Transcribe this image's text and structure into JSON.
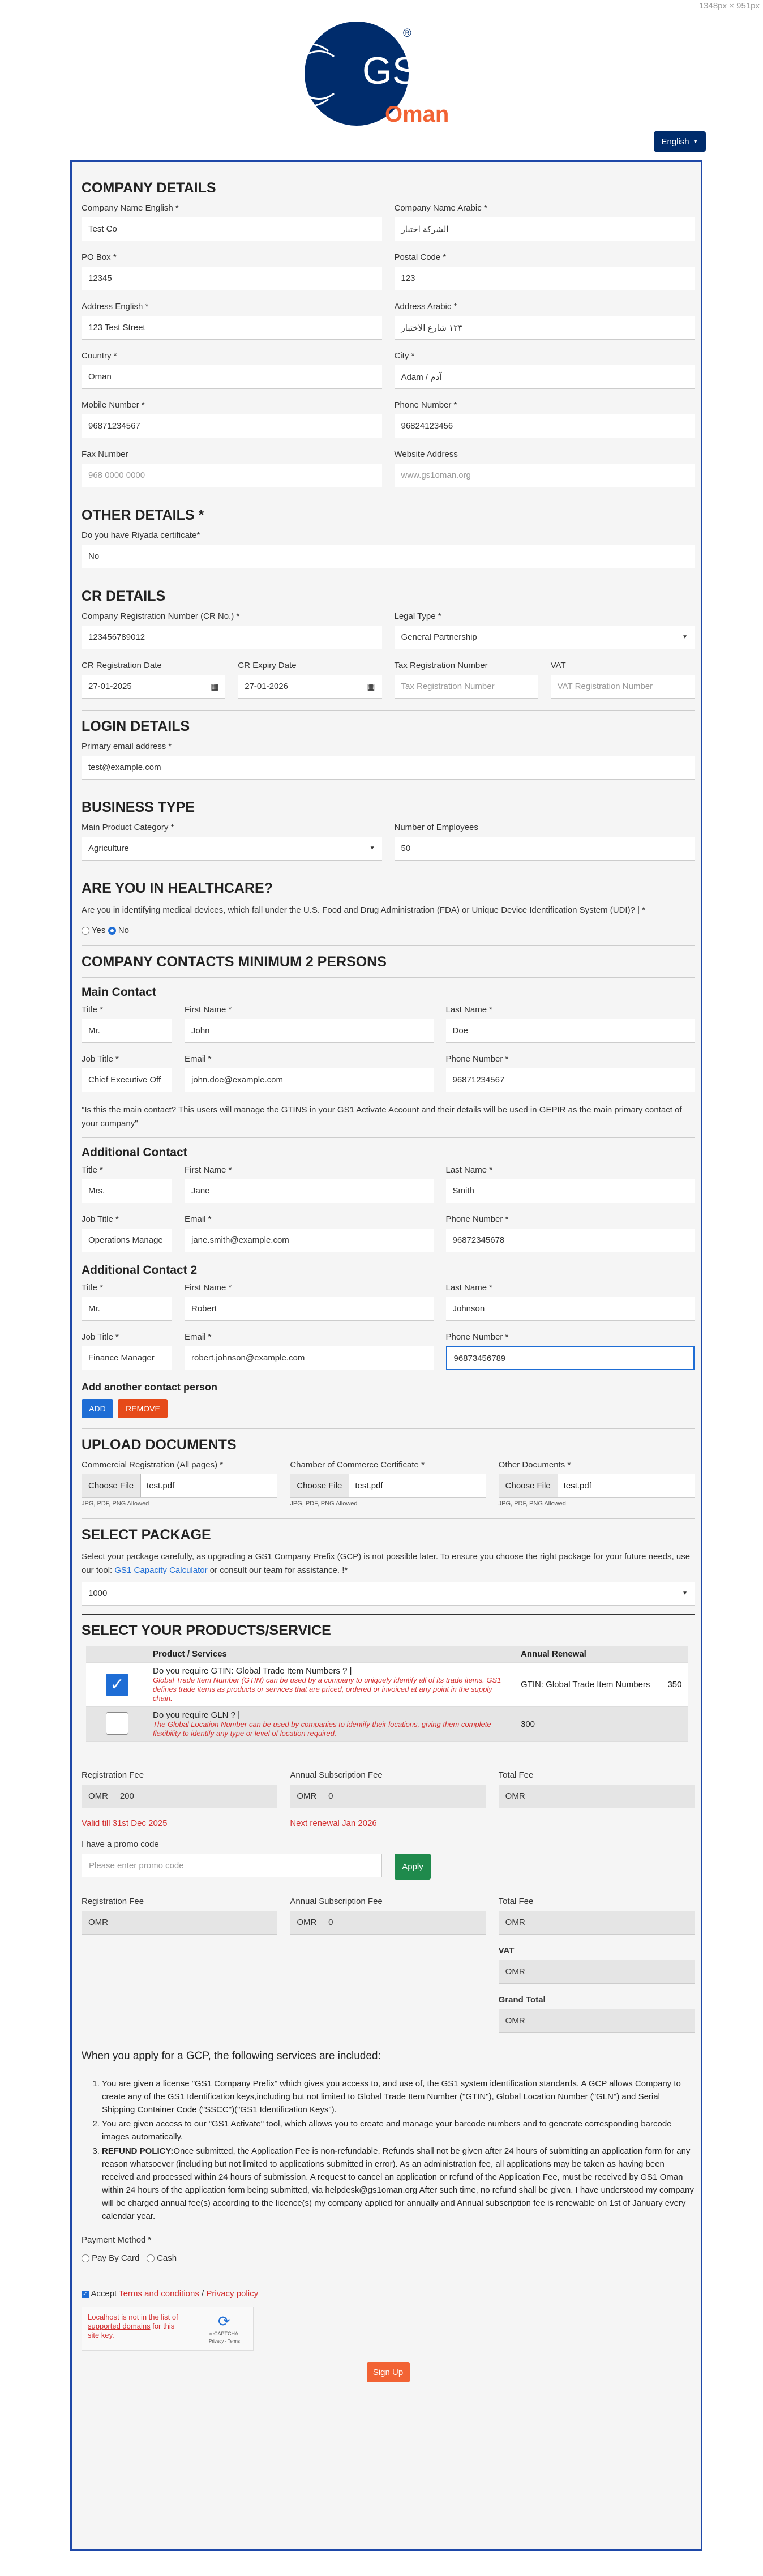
{
  "viewport_label": "1348px × 951px",
  "brand": {
    "logo_text": "GS1",
    "registered": "®",
    "country": "Oman"
  },
  "lang_button": "English",
  "company": {
    "title": "COMPANY DETAILS",
    "name_en_label": "Company Name English *",
    "name_en": "Test Co",
    "name_ar_label": "Company Name Arabic *",
    "name_ar": "الشركة اختبار",
    "pobox_label": "PO Box *",
    "pobox": "12345",
    "postal_label": "Postal Code *",
    "postal": "123",
    "addr_en_label": "Address English *",
    "addr_en": "123 Test Street",
    "addr_ar_label": "Address Arabic *",
    "addr_ar": "١٢٣ شارع الاختبار",
    "country_label": "Country *",
    "country": "Oman",
    "city_label": "City *",
    "city": "Adam / آدم",
    "mobile_label": "Mobile Number *",
    "mobile": "96871234567",
    "phone_label": "Phone Number *",
    "phone": "96824123456",
    "fax_label": "Fax Number",
    "fax_ph": "968 0000 0000",
    "website_label": "Website Address",
    "website_ph": "www.gs1oman.org"
  },
  "other": {
    "title": "OTHER DETAILS *",
    "q": "Do you have Riyada certificate*",
    "value": "No"
  },
  "cr": {
    "title": "CR DETAILS",
    "crno_label": "Company Registration Number (CR No.) *",
    "crno": "123456789012",
    "legal_label": "Legal Type *",
    "legal": "General Partnership",
    "regdate_label": "CR Registration Date",
    "regdate": "27-01-2025",
    "expdate_label": "CR Expiry Date",
    "expdate": "27-01-2026",
    "tax_label": "Tax Registration Number",
    "tax_ph": "Tax Registration Number",
    "vat_label": "VAT",
    "vat_ph": "VAT Registration Number"
  },
  "login": {
    "title": "LOGIN DETAILS",
    "email_label": "Primary email address *",
    "email": "test@example.com"
  },
  "business": {
    "title": "BUSINESS TYPE",
    "cat_label": "Main Product Category *",
    "cat": "Agriculture",
    "emp_label": "Number of Employees",
    "emp": "50"
  },
  "health": {
    "title": "ARE YOU IN HEALTHCARE?",
    "q": "Are you in identifying medical devices, which fall under the U.S. Food and Drug Administration (FDA) or Unique Device Identification System (UDI)? | *",
    "yes": "Yes",
    "no": "No"
  },
  "contacts": {
    "title": "COMPANY CONTACTS MINIMUM 2 PERSONS",
    "main_title": "Main Contact",
    "title_label": "Title *",
    "first_label": "First Name *",
    "last_label": "Last Name *",
    "job_label": "Job Title *",
    "email_label": "Email *",
    "phone_label": "Phone Number *",
    "main": {
      "title": "Mr.",
      "first": "John",
      "last": "Doe",
      "job": "Chief Executive Off",
      "email": "john.doe@example.com",
      "phone": "96871234567"
    },
    "main_note": "\"Is this the main contact? This users will manage the GTINS in your GS1 Activate Account and their details will be used in GEPIR as the main primary contact of your company\"",
    "add_title": "Additional Contact",
    "add": {
      "title": "Mrs.",
      "first": "Jane",
      "last": "Smith",
      "job": "Operations Manage",
      "email": "jane.smith@example.com",
      "phone": "96872345678"
    },
    "add2_title": "Additional Contact 2",
    "add2": {
      "title": "Mr.",
      "first": "Robert",
      "last": "Johnson",
      "job": "Finance Manager",
      "email": "robert.johnson@example.com",
      "phone": "96873456789"
    },
    "add_another": "Add another contact person",
    "add_btn": "ADD",
    "remove_btn": "REMOVE"
  },
  "upload": {
    "title": "UPLOAD DOCUMENTS",
    "cr_label": "Commercial Registration (All pages) *",
    "cc_label": "Chamber of Commerce Certificate *",
    "other_label": "Other Documents *",
    "choose": "Choose File",
    "file": "test.pdf",
    "allowed": "JPG, PDF, PNG Allowed"
  },
  "package": {
    "title": "SELECT PACKAGE",
    "text1": "Select your package carefully, as upgrading a GS1 Company Prefix (GCP) is not possible later. To ensure you choose the right package for your future needs, use our tool:",
    "link": "GS1 Capacity Calculator",
    "text2": "or consult our team for assistance. !*",
    "value": "1000"
  },
  "products": {
    "title": "SELECT YOUR PRODUCTS/SERVICE",
    "col_product": "Product / Services",
    "col_fee": "Annual Renewal",
    "rows": [
      {
        "q": "Do you require GTIN: Global Trade Item Numbers ? |",
        "desc": "Global Trade Item Number (GTIN) can be used by a company to uniquely identify all of its trade items. GS1 defines trade items as products or services that are priced, ordered or invoiced at any point in the supply chain.",
        "renewal": "GTIN: Global Trade Item Numbers",
        "amount": "350",
        "checked": true
      },
      {
        "q": "Do you require GLN ? |",
        "desc": "The Global Location Number can be used by companies to identify their locations, giving them complete flexibility to identify any type or level of location required.",
        "renewal": "300",
        "amount": "",
        "checked": false
      }
    ]
  },
  "fees": {
    "reg_label": "Registration Fee",
    "annual_label": "Annual Subscription Fee",
    "total_label": "Total Fee",
    "cur": "OMR",
    "reg": "200",
    "annual": "0",
    "total": "",
    "valid": "Valid till 31st Dec 2025",
    "next": "Next renewal Jan 2026",
    "promo_label": "I have a promo code",
    "promo_ph": "Please enter promo code",
    "apply": "Apply",
    "reg2": "",
    "annual2": "0",
    "total2": "",
    "vat_label": "VAT",
    "vat": "",
    "grand_label": "Grand Total",
    "grand": ""
  },
  "services": {
    "title": "When you apply for a GCP, the following services are included:",
    "items": [
      "You are given a license \"GS1 Company Prefix\" which gives you access to, and use of, the GS1 system identification standards. A GCP allows Company to create any of the GS1 Identification keys,including but not limited to Global Trade Item Number (\"GTIN\"), Global Location Number (\"GLN\") and Serial Shipping Container Code (\"SSCC\")(\"GS1 Identification Keys\").",
      "You are given access to our \"GS1 Activate\" tool, which allows you to create and manage your barcode numbers and to generate corresponding barcode images automatically."
    ],
    "refund_head": "REFUND POLICY:",
    "refund": "Once submitted, the Application Fee is non-refundable. Refunds shall not be given after 24 hours of submitting an application form for any reason whatsoever (including but not limited to applications submitted in error). As an administration fee, all applications may be taken as having been received and processed within 24 hours of submission. A request to cancel an application or refund of the Application Fee, must be received by GS1 Oman within 24 hours of the application form being submitted, via helpdesk@gs1oman.org After such time, no refund shall be given. I have understood my company will be charged annual fee(s) according to the licence(s) my company applied for annually and Annual subscription fee is renewable on 1st of January every calendar year."
  },
  "payment": {
    "label": "Payment Method *",
    "card": "Pay By Card",
    "cash": "Cash"
  },
  "terms": {
    "accept": "Accept",
    "terms": "Terms and conditions",
    "slash": "/",
    "privacy": "Privacy policy"
  },
  "recaptcha": {
    "error1": "Localhost is not in the list of",
    "error_link": "supported domains",
    "error2": "for this site key.",
    "brand": "reCAPTCHA",
    "links": "Privacy - Terms"
  },
  "signup": "Sign Up",
  "colors": {
    "brand_blue": "#002c6c",
    "brand_orange": "#f26334",
    "border_blue": "#1e48a8",
    "add_btn": "#1e6dd5",
    "remove_btn": "#e64a19",
    "apply_btn": "#1f8a4c",
    "signup_btn": "#f26334"
  }
}
